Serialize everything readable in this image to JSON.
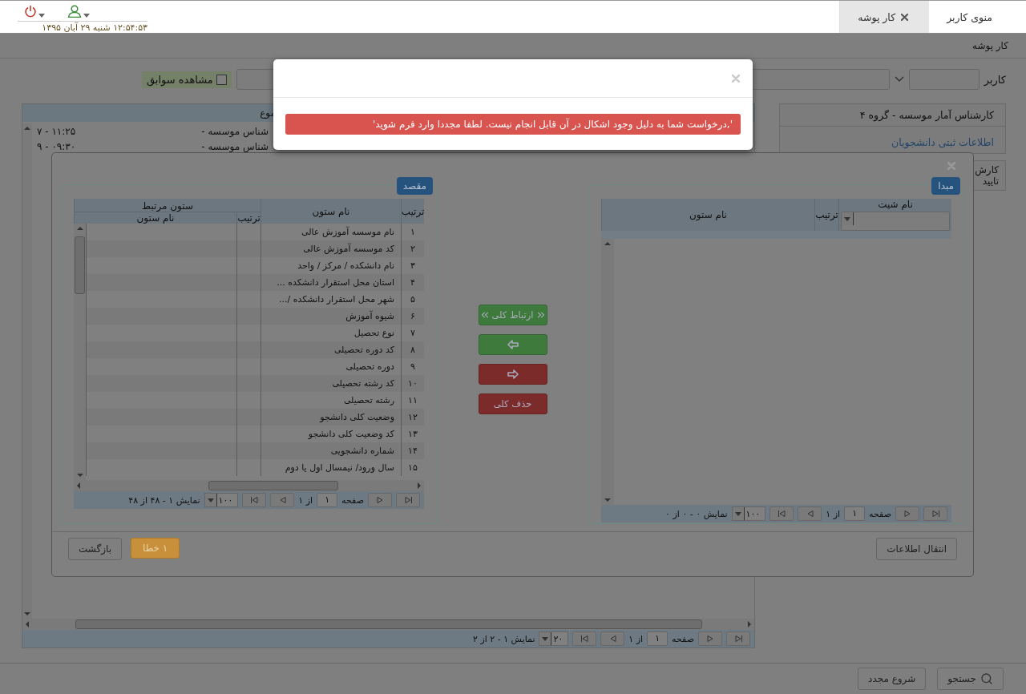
{
  "top_bar": {
    "tabs": [
      {
        "label": "منوی کاربر",
        "selected": false,
        "closable": false
      },
      {
        "label": "کار پوشه",
        "selected": true,
        "closable": true
      }
    ],
    "datetime": "۱۲:۵۴:۵۳ شنبه ۲۹ آبان ۱۳۹۵"
  },
  "breadcrumb": "کار پوشه",
  "filter": {
    "user_label": "کاربر",
    "history_checkbox": {
      "label": "مشاهده سوابق",
      "checked": false
    }
  },
  "side_panel": {
    "title": "کارشناس آمار موسسه - گروه ۴",
    "link": "اطلاعات ثبتی دانشجویان",
    "tab": "کارش تایید"
  },
  "list_table": {
    "column_1": "موع",
    "rows": [
      {
        "cell_1": "شناس موسسه -",
        "cell_2": "۱۱:۲۵ - ۷"
      },
      {
        "cell_1": "شناس موسسه -",
        "cell_2": "۰۹:۳۰ - ۹"
      }
    ],
    "pager": {
      "page_label": "صفحه",
      "page": "۱",
      "of": "از ۱",
      "page_size": "۲۰",
      "summary": "نمایش ۱ - ۲ از ۲"
    }
  },
  "bottom_bar": {
    "search": "جستجو",
    "restart": "شروع مجدد"
  },
  "mapping_dialog": {
    "source": {
      "title": "مبدا",
      "sheet_column": "نام شیت",
      "order_column": "ترتیب",
      "name_column": "نام ستون",
      "pager": {
        "page_label": "صفحه",
        "page": "۱",
        "of": "از ۱",
        "page_size": "۱۰۰",
        "summary": "نمایش ۰ - ۰ از ۰"
      }
    },
    "actions": [
      {
        "kind": "link_all",
        "label": "ارتباط کلی"
      },
      {
        "kind": "add"
      },
      {
        "kind": "remove"
      },
      {
        "kind": "remove_all",
        "label": "حذف کلی"
      }
    ],
    "target": {
      "title": "مقصد",
      "order_column": "ترتیب",
      "name_column": "نام ستون",
      "group_column": "ستون مرتبط",
      "sub_order_column": "ترتیب",
      "sub_name_column": "نام ستون",
      "rows": [
        {
          "order": "۱",
          "name": "نام موسسه آموزش عالی"
        },
        {
          "order": "۲",
          "name": "کد موسسه آموزش عالی"
        },
        {
          "order": "۳",
          "name": "نام دانشکده / مرکز / واحد"
        },
        {
          "order": "۴",
          "name": "استان محل استقرار دانشکده ..."
        },
        {
          "order": "۵",
          "name": "شهر محل استقرار دانشکده /..."
        },
        {
          "order": "۶",
          "name": "شیوه آموزش"
        },
        {
          "order": "۷",
          "name": "نوع تحصیل"
        },
        {
          "order": "۸",
          "name": "کد دوره تحصیلی"
        },
        {
          "order": "۹",
          "name": "دوره تحصیلی"
        },
        {
          "order": "۱۰",
          "name": "کد رشته تحصیلی"
        },
        {
          "order": "۱۱",
          "name": "رشته تحصیلی"
        },
        {
          "order": "۱۲",
          "name": "وضعیت کلی دانشجو"
        },
        {
          "order": "۱۳",
          "name": "کد وضعیت کلی دانشجو"
        },
        {
          "order": "۱۴",
          "name": "شماره دانشجویی"
        },
        {
          "order": "۱۵",
          "name": "سال ورود/ نیمسال اول یا دوم"
        }
      ],
      "pager": {
        "page_label": "صفحه",
        "page": "۱",
        "of": "از ۱",
        "page_size": "۱۰۰",
        "summary": "نمایش ۱ - ۴۸ از ۴۸"
      }
    },
    "footer": {
      "transfer": "انتقال اطلاعات",
      "errors": "۱ خطا",
      "back": "بازگشت"
    }
  },
  "alert_dialog": {
    "message": "',درخواست شما به دلیل وجود اشکال در آن قابل انجام نیست. لطفا مجددا وارد فرم شوید'"
  }
}
